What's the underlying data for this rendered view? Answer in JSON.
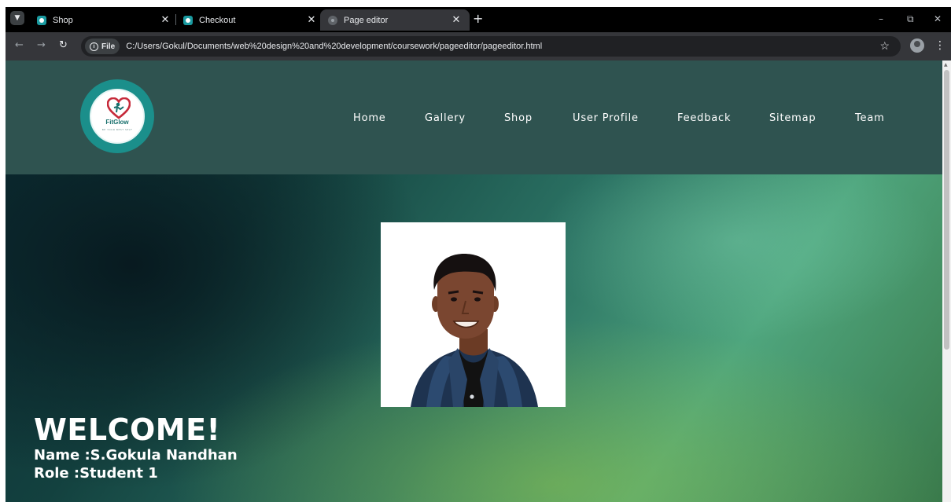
{
  "browser": {
    "tabs": [
      {
        "title": "Shop",
        "active": false
      },
      {
        "title": "Checkout",
        "active": false
      },
      {
        "title": "Page editor",
        "active": true
      }
    ],
    "new_tab_symbol": "+",
    "address": {
      "chip_label": "File",
      "url": "C:/Users/Gokul/Documents/web%20design%20and%20development/coursework/pageeditor/pageeditor.html"
    },
    "icons": {
      "back": "back-arrow-icon",
      "forward": "forward-arrow-icon",
      "reload": "reload-icon",
      "bookmark": "star-icon",
      "profile": "profile-icon",
      "menu": "kebab-menu-icon"
    }
  },
  "site": {
    "logo": {
      "text": "FitGlow",
      "tagline": "BE YOUR BEST SELF"
    },
    "nav": [
      {
        "label": "Home"
      },
      {
        "label": "Gallery"
      },
      {
        "label": "Shop"
      },
      {
        "label": "User Profile"
      },
      {
        "label": "Feedback"
      },
      {
        "label": "Sitemap"
      },
      {
        "label": "Team"
      }
    ],
    "header_color": "#2f5350",
    "brand_color": "#1b8f8b"
  },
  "profile": {
    "welcome": "WELCOME!",
    "name_line": "Name :S.Gokula Nandhan",
    "role_line": "Role :Student 1"
  }
}
